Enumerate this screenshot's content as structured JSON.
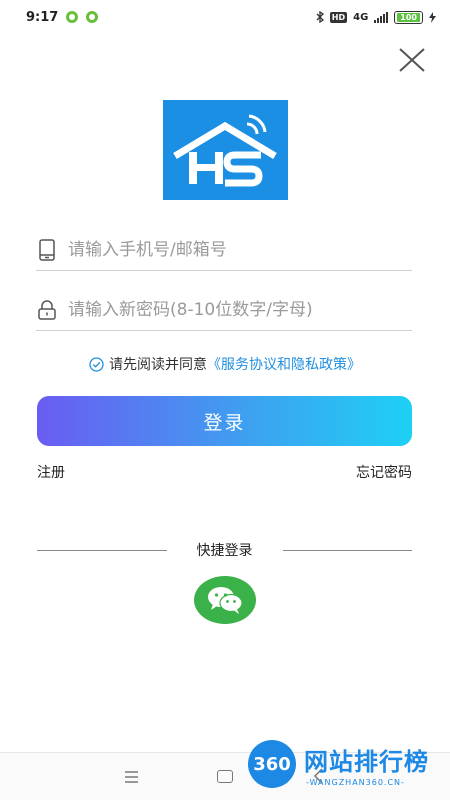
{
  "status_bar": {
    "time": "9:17",
    "network": "4G",
    "battery": "100"
  },
  "form": {
    "phone_placeholder": "请输入手机号/邮箱号",
    "password_placeholder": "请输入新密码(8-10位数字/字母)"
  },
  "agreement": {
    "prefix": "请先阅读并同意",
    "link": "《服务协议和隐私政策》"
  },
  "buttons": {
    "login": "登录",
    "register": "注册",
    "forgot_password": "忘记密码"
  },
  "quick_login": {
    "label": "快捷登录"
  },
  "watermark": {
    "badge": "360",
    "title": "网站排行榜",
    "url": "-WANGZHAN360.CN-"
  },
  "colors": {
    "accent": "#1f8fe0",
    "logo_bg": "#1a8fe4",
    "wechat": "#3bb14a"
  }
}
